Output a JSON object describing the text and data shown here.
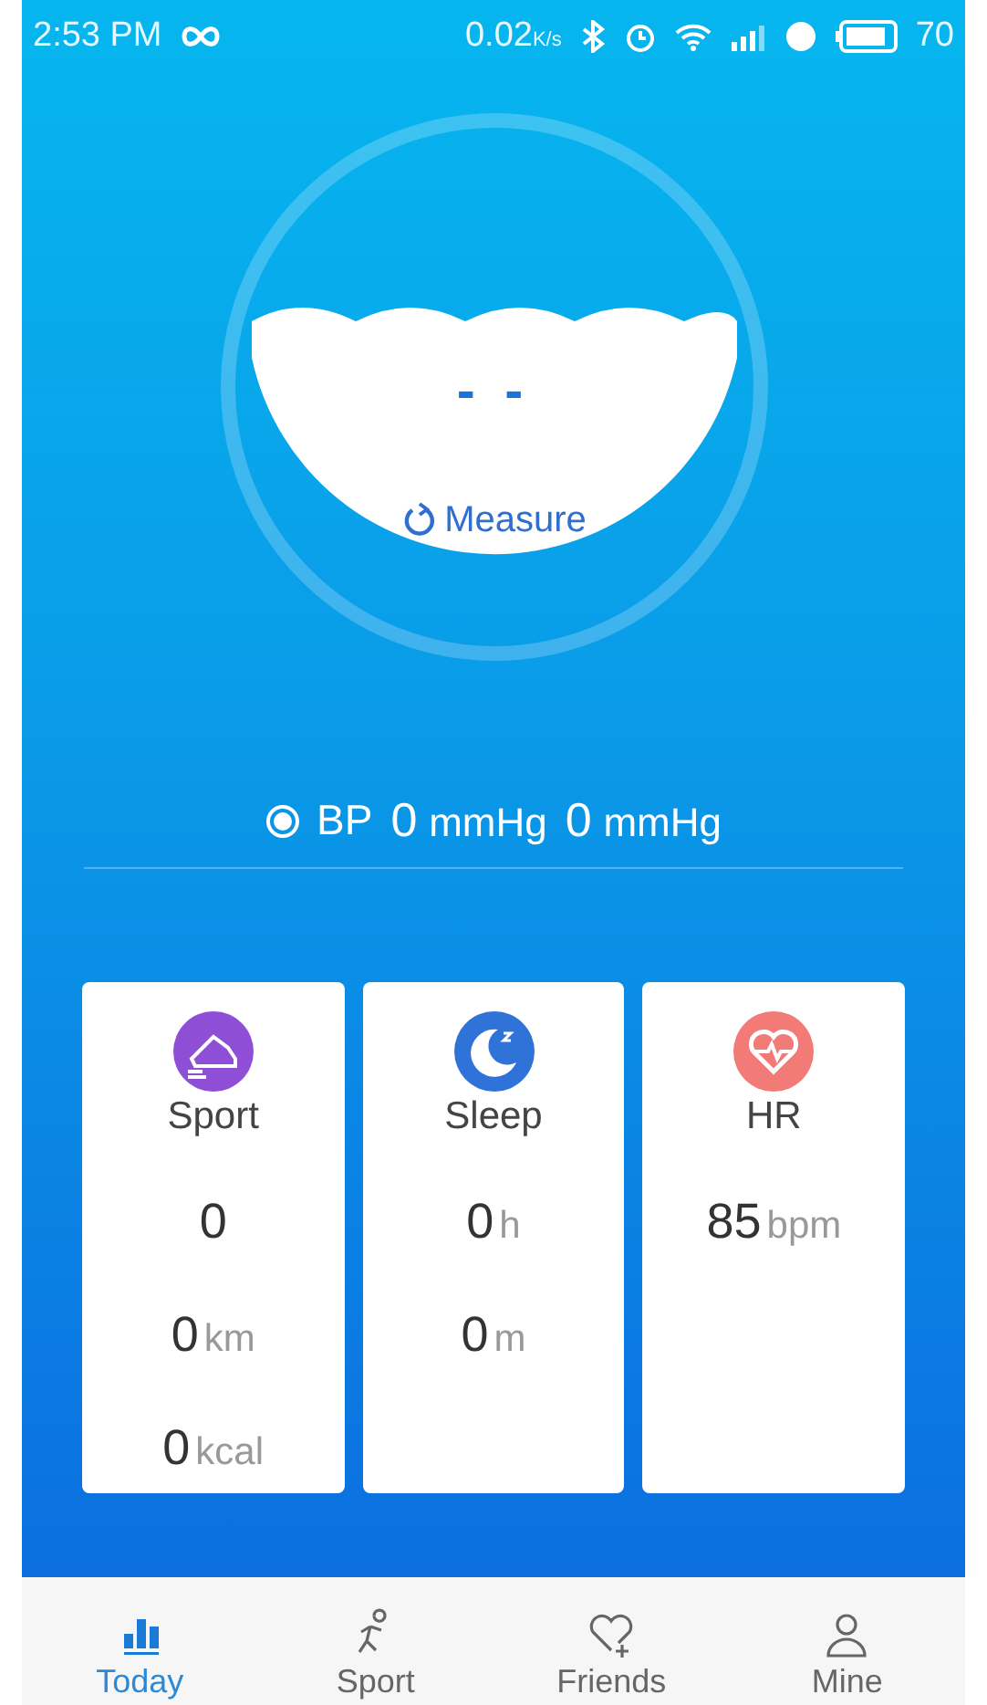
{
  "status_bar": {
    "time": "2:53 PM",
    "speed": "0.02",
    "speed_unit": "K/s",
    "battery": "70"
  },
  "gauge": {
    "value": "- -",
    "action": "Measure"
  },
  "bp": {
    "selected": true,
    "label": "BP",
    "readings": [
      {
        "value": "0",
        "unit": "mmHg"
      },
      {
        "value": "0",
        "unit": "mmHg"
      }
    ]
  },
  "cards": [
    {
      "kind": "sport",
      "title": "Sport",
      "color": "#8e4fd6",
      "rows": [
        {
          "value": "0"
        },
        {
          "value": "0",
          "unit": "km"
        },
        {
          "value": "0",
          "unit": "kcal"
        }
      ]
    },
    {
      "kind": "sleep",
      "title": "Sleep",
      "color": "#2f73d9",
      "rows": [
        {
          "value": "0",
          "unit": "h"
        },
        {
          "value": "0",
          "unit": "m"
        }
      ]
    },
    {
      "kind": "hr",
      "title": "HR",
      "color": "#f27b78",
      "rows": [
        {
          "value": "85",
          "unit": "bpm"
        }
      ]
    }
  ],
  "tabs": [
    {
      "kind": "today",
      "label": "Today",
      "selected": true
    },
    {
      "kind": "sport",
      "label": "Sport",
      "selected": false
    },
    {
      "kind": "friends",
      "label": "Friends",
      "selected": false
    },
    {
      "kind": "mine",
      "label": "Mine",
      "selected": false
    }
  ]
}
